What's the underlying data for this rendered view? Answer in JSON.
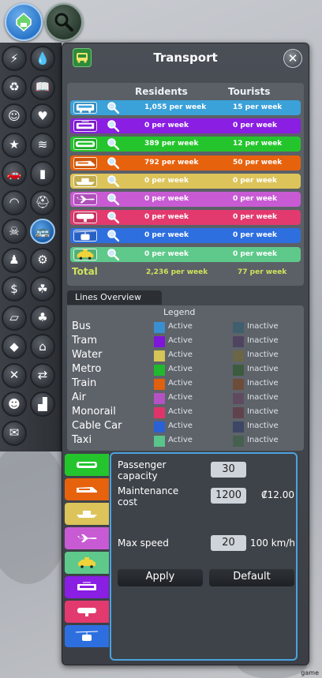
{
  "top_buttons": [
    {
      "name": "zoning-tool-button",
      "icon": "map-pin-icon",
      "color": "#2b76c9"
    },
    {
      "name": "info-search-button",
      "icon": "magnifier-icon",
      "color": "#2f4a3a"
    }
  ],
  "sidebar": {
    "items": [
      {
        "icon": "electricity-icon",
        "glyph": "⚡"
      },
      {
        "icon": "water-drop-icon",
        "glyph": "💧"
      },
      {
        "icon": "garbage-icon",
        "glyph": "♻"
      },
      {
        "icon": "education-icon",
        "glyph": "📖"
      },
      {
        "icon": "happiness-icon",
        "glyph": "☺"
      },
      {
        "icon": "health-icon",
        "glyph": "♥"
      },
      {
        "icon": "landmark-icon",
        "glyph": "★"
      },
      {
        "icon": "wind-icon",
        "glyph": "≋"
      },
      {
        "icon": "traffic-icon",
        "glyph": "🚗"
      },
      {
        "icon": "fire-icon",
        "glyph": "▮"
      },
      {
        "icon": "noise-icon",
        "glyph": "◠"
      },
      {
        "icon": "police-icon",
        "glyph": "⛑"
      },
      {
        "icon": "crime-icon",
        "glyph": "☠"
      },
      {
        "icon": "transport-icon",
        "glyph": "🚌"
      },
      {
        "icon": "population-icon",
        "glyph": "♟"
      },
      {
        "icon": "industry-icon",
        "glyph": "⚙"
      },
      {
        "icon": "economy-icon",
        "glyph": "$"
      },
      {
        "icon": "natural-resources-icon",
        "glyph": "☘"
      },
      {
        "icon": "road-icon",
        "glyph": "▱"
      },
      {
        "icon": "park-icon",
        "glyph": "♣"
      },
      {
        "icon": "land-value-icon",
        "glyph": "◆"
      },
      {
        "icon": "heating-icon",
        "glyph": "⌂"
      },
      {
        "icon": "maintenance-icon",
        "glyph": "✕"
      },
      {
        "icon": "routes-icon",
        "glyph": "⇄"
      },
      {
        "icon": "tourism-icon",
        "glyph": "☻"
      },
      {
        "icon": "factory-icon",
        "glyph": "▟"
      },
      {
        "icon": "mail-icon",
        "glyph": "✉"
      }
    ]
  },
  "panel": {
    "title": "Transport",
    "close_glyph": "✕",
    "columns": {
      "residents": "Residents",
      "tourists": "Tourists"
    },
    "rows": [
      {
        "mode": "Bus",
        "color": "#3aa1d9",
        "vehicle_icon": "bus-icon",
        "residents": "1,055 per week",
        "tourists": "15 per week"
      },
      {
        "mode": "Tram",
        "color": "#8a1ee3",
        "vehicle_icon": "tram-icon",
        "residents": "0 per week",
        "tourists": "0 per week"
      },
      {
        "mode": "Metro",
        "color": "#24c52c",
        "vehicle_icon": "metro-icon",
        "residents": "389 per week",
        "tourists": "12 per week"
      },
      {
        "mode": "Train",
        "color": "#e7620d",
        "vehicle_icon": "train-icon",
        "residents": "792 per week",
        "tourists": "50 per week"
      },
      {
        "mode": "Water",
        "color": "#dcc45a",
        "vehicle_icon": "ship-icon",
        "residents": "0 per week",
        "tourists": "0 per week"
      },
      {
        "mode": "Air",
        "color": "#c85bd3",
        "vehicle_icon": "airplane-icon",
        "residents": "0 per week",
        "tourists": "0 per week"
      },
      {
        "mode": "Monorail",
        "color": "#e23a6e",
        "vehicle_icon": "monorail-icon",
        "residents": "0 per week",
        "tourists": "0 per week"
      },
      {
        "mode": "Cable Car",
        "color": "#2e6fe0",
        "vehicle_icon": "cable-car-icon",
        "residents": "0 per week",
        "tourists": "0 per week"
      },
      {
        "mode": "Taxi",
        "color": "#5ec98a",
        "vehicle_icon": "taxi-icon",
        "residents": "0 per week",
        "tourists": "0 per week"
      }
    ],
    "total": {
      "label": "Total",
      "residents": "2,236 per week",
      "tourists": "77 per week",
      "color": "#cfe35a"
    }
  },
  "lines_overview": {
    "tab_label": "Lines Overview",
    "legend_title": "Legend",
    "active_label": "Active",
    "inactive_label": "Inactive",
    "items": [
      {
        "name": "Bus",
        "active": "#3a8fd0",
        "inactive": "#3f5f6e"
      },
      {
        "name": "Tram",
        "active": "#7d16d9",
        "inactive": "#4f4460"
      },
      {
        "name": "Water",
        "active": "#d5c456",
        "inactive": "#6a6646"
      },
      {
        "name": "Metro",
        "active": "#20b82c",
        "inactive": "#3b5c3e"
      },
      {
        "name": "Train",
        "active": "#e0600e",
        "inactive": "#6e4c3a"
      },
      {
        "name": "Air",
        "active": "#b452c4",
        "inactive": "#5f4a60"
      },
      {
        "name": "Monorail",
        "active": "#df346a",
        "inactive": "#60424d"
      },
      {
        "name": "Cable Car",
        "active": "#2a62d6",
        "inactive": "#3d4664"
      },
      {
        "name": "Taxi",
        "active": "#58c58a",
        "inactive": "#46604f"
      }
    ]
  },
  "vehicle_tabs": [
    {
      "icon": "metro-icon",
      "color": "#24c52c"
    },
    {
      "icon": "train-icon",
      "color": "#e7620d"
    },
    {
      "icon": "ship-icon",
      "color": "#dcc45a"
    },
    {
      "icon": "airplane-icon",
      "color": "#c85bd3"
    },
    {
      "icon": "taxi-icon",
      "color": "#5ec98a"
    },
    {
      "icon": "tram-icon",
      "color": "#8a1ee3"
    },
    {
      "icon": "monorail-icon",
      "color": "#e23a6e"
    },
    {
      "icon": "cable-car-icon",
      "color": "#2e6fe0"
    }
  ],
  "vehicle_details": {
    "passenger_capacity_label": "Passenger\ncapacity",
    "passenger_capacity_value": "30",
    "maintenance_cost_label": "Maintenance\ncost",
    "maintenance_cost_value": "1200",
    "maintenance_cost_money": "₡12.00",
    "max_speed_label": "Max speed",
    "max_speed_value": "20",
    "max_speed_unit": "100 km/h",
    "apply_label": "Apply",
    "default_label": "Default"
  },
  "footer": {
    "watermark": "game"
  }
}
